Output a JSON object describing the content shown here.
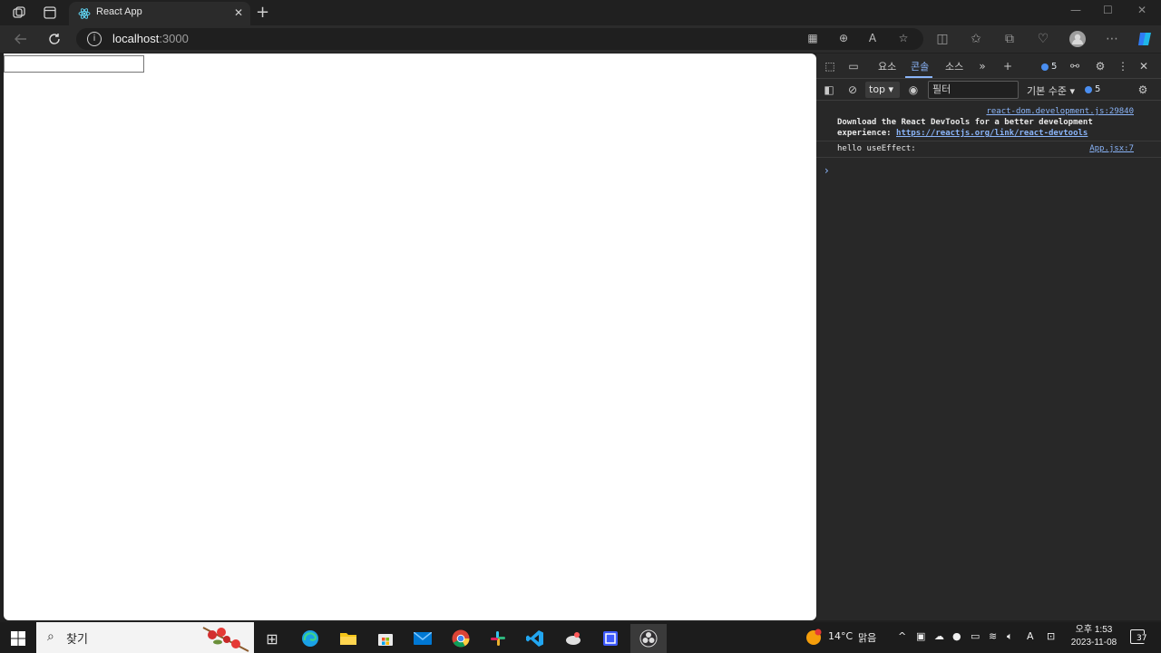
{
  "browser": {
    "tab_title": "React App",
    "url_host": "localhost",
    "url_port": ":3000"
  },
  "devtools": {
    "tabs": [
      "요소",
      "콘솔",
      "소스"
    ],
    "issues_count": "5",
    "context": "top",
    "filter_placeholder": "필터",
    "levels": "기본 수준",
    "messages_count": "5",
    "console": {
      "msg1_source": "react-dom.development.js:29840",
      "msg1_text": "Download the React DevTools for a better development experience: ",
      "msg1_link": "https://reactjs.org/link/react-devtools",
      "msg2_text": "hello useEffect:",
      "msg2_source": "App.jsx:7"
    }
  },
  "taskbar": {
    "search_label": "찾기",
    "weather_temp": "14°C",
    "weather_desc": "맑음",
    "time_label": "오후 1:53",
    "date_label": "2023-11-08",
    "notification_count": "37"
  },
  "colors": {
    "accent": "#8ab4f8",
    "background": "#202020"
  }
}
